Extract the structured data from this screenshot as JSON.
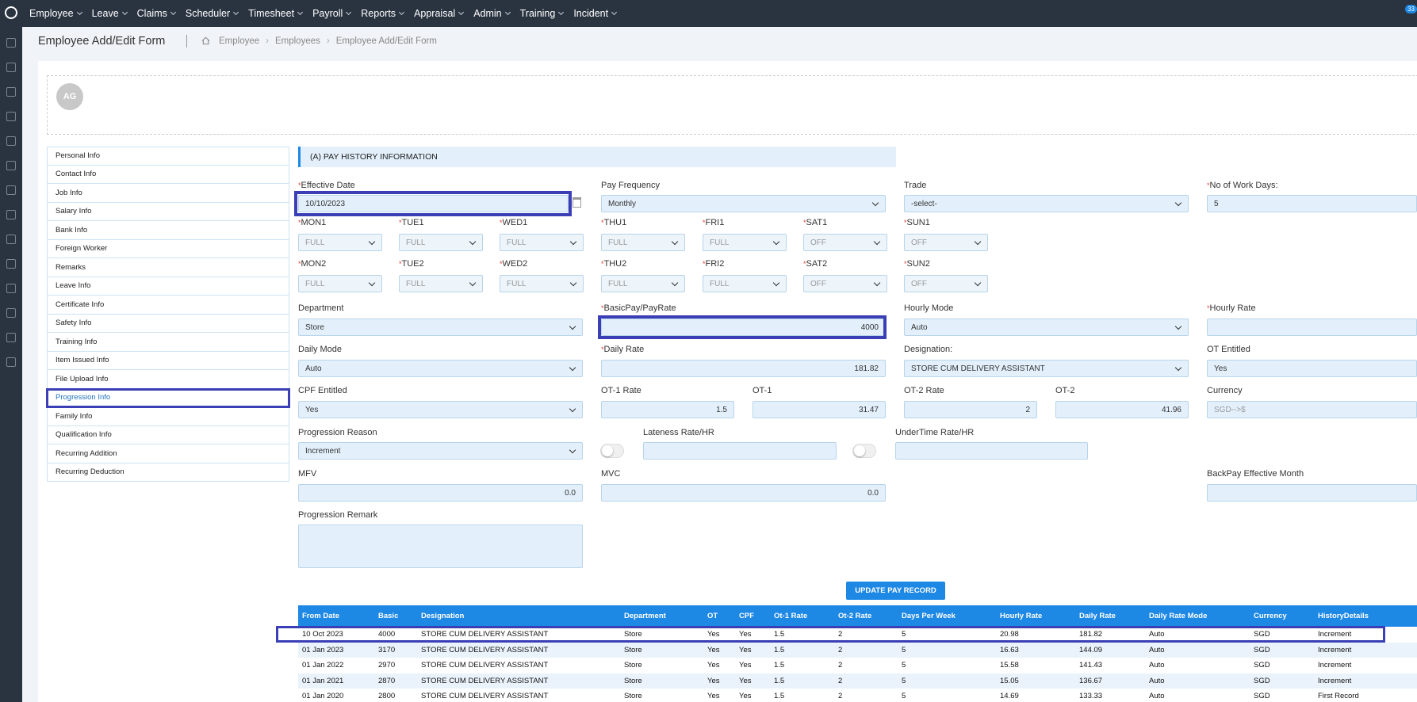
{
  "topnav": {
    "menu": [
      {
        "label": "Employee",
        "name": "menu-employee"
      },
      {
        "label": "Leave",
        "name": "menu-leave"
      },
      {
        "label": "Claims",
        "name": "menu-claims"
      },
      {
        "label": "Scheduler",
        "name": "menu-scheduler"
      },
      {
        "label": "Timesheet",
        "name": "menu-timesheet"
      },
      {
        "label": "Payroll",
        "name": "menu-payroll"
      },
      {
        "label": "Reports",
        "name": "menu-reports"
      },
      {
        "label": "Appraisal",
        "name": "menu-appraisal"
      },
      {
        "label": "Admin",
        "name": "menu-admin"
      },
      {
        "label": "Training",
        "name": "menu-training"
      },
      {
        "label": "Incident",
        "name": "menu-incident"
      }
    ],
    "notification_count": "33"
  },
  "header": {
    "title": "Employee Add/Edit Form",
    "breadcrumbs": [
      "Employee",
      "Employees",
      "Employee Add/Edit Form"
    ]
  },
  "avatar": {
    "initials": "AG"
  },
  "subnav": {
    "items": [
      "Personal Info",
      "Contact Info",
      "Job Info",
      "Salary Info",
      "Bank Info",
      "Foreign Worker",
      "Remarks",
      "Leave Info",
      "Certificate Info",
      "Safety Info",
      "Training Info",
      "Item Issued Info",
      "File Upload Info",
      "Progression Info",
      "Family Info",
      "Qualification Info",
      "Recurring Addition",
      "Recurring Deduction"
    ],
    "active": "Progression Info"
  },
  "form": {
    "section_title": "(A) PAY HISTORY INFORMATION",
    "effective_date": {
      "label": "Effective Date",
      "value": "10/10/2023"
    },
    "pay_frequency": {
      "label": "Pay Frequency",
      "value": "Monthly"
    },
    "trade": {
      "label": "Trade",
      "value": "-select-"
    },
    "work_days": {
      "label": "No of Work Days:",
      "value": "5"
    },
    "week1": [
      {
        "label": "MON1",
        "value": "FULL"
      },
      {
        "label": "TUE1",
        "value": "FULL"
      },
      {
        "label": "WED1",
        "value": "FULL"
      },
      {
        "label": "THU1",
        "value": "FULL"
      },
      {
        "label": "FRI1",
        "value": "FULL"
      },
      {
        "label": "SAT1",
        "value": "OFF"
      },
      {
        "label": "SUN1",
        "value": "OFF"
      }
    ],
    "week2": [
      {
        "label": "MON2",
        "value": "FULL"
      },
      {
        "label": "TUE2",
        "value": "FULL"
      },
      {
        "label": "WED2",
        "value": "FULL"
      },
      {
        "label": "THU2",
        "value": "FULL"
      },
      {
        "label": "FRI2",
        "value": "FULL"
      },
      {
        "label": "SAT2",
        "value": "OFF"
      },
      {
        "label": "SUN2",
        "value": "OFF"
      }
    ],
    "department": {
      "label": "Department",
      "value": "Store"
    },
    "basic_pay": {
      "label": "BasicPay/PayRate",
      "value": "4000"
    },
    "hourly_mode": {
      "label": "Hourly Mode",
      "value": "Auto"
    },
    "hourly_rate": {
      "label": "Hourly Rate",
      "value": ""
    },
    "daily_mode": {
      "label": "Daily Mode",
      "value": "Auto"
    },
    "daily_rate": {
      "label": "Daily Rate",
      "value": "181.82"
    },
    "designation": {
      "label": "Designation:",
      "value": "STORE CUM DELIVERY ASSISTANT"
    },
    "ot_entitled": {
      "label": "OT Entitled",
      "value": "Yes"
    },
    "cpf_entitled": {
      "label": "CPF Entitled",
      "value": "Yes"
    },
    "ot1_rate": {
      "label": "OT-1 Rate",
      "value": "1.5"
    },
    "ot1": {
      "label": "OT-1",
      "value": "31.47"
    },
    "ot2_rate": {
      "label": "OT-2 Rate",
      "value": "2"
    },
    "ot2": {
      "label": "OT-2",
      "value": "41.96"
    },
    "currency": {
      "label": "Currency",
      "value": "SGD-->$"
    },
    "progression_reason": {
      "label": "Progression Reason",
      "value": "Increment"
    },
    "lateness_rate": {
      "label": "Lateness Rate/HR",
      "value": ""
    },
    "undertime_rate": {
      "label": "UnderTime Rate/HR",
      "value": ""
    },
    "mfv": {
      "label": "MFV",
      "value": "0.0"
    },
    "mvc": {
      "label": "MVC",
      "value": "0.0"
    },
    "backpay_month": {
      "label": "BackPay Effective Month",
      "value": ""
    },
    "progression_remark": {
      "label": "Progression Remark",
      "value": ""
    },
    "update_button": "UPDATE PAY RECORD"
  },
  "history": {
    "columns": [
      "From Date",
      "Basic",
      "Designation",
      "Department",
      "OT",
      "CPF",
      "Ot-1 Rate",
      "Ot-2 Rate",
      "Days Per Week",
      "Hourly Rate",
      "Daily Rate",
      "Daily Rate Mode",
      "Currency",
      "HistoryDetails"
    ],
    "rows": [
      [
        "10 Oct 2023",
        "4000",
        "STORE CUM DELIVERY ASSISTANT",
        "Store",
        "Yes",
        "Yes",
        "1.5",
        "2",
        "5",
        "20.98",
        "181.82",
        "Auto",
        "SGD",
        "Increment"
      ],
      [
        "01 Jan 2023",
        "3170",
        "STORE CUM DELIVERY ASSISTANT",
        "Store",
        "Yes",
        "Yes",
        "1.5",
        "2",
        "5",
        "16.63",
        "144.09",
        "Auto",
        "SGD",
        "Increment"
      ],
      [
        "01 Jan 2022",
        "2970",
        "STORE CUM DELIVERY ASSISTANT",
        "Store",
        "Yes",
        "Yes",
        "1.5",
        "2",
        "5",
        "15.58",
        "141.43",
        "Auto",
        "SGD",
        "Increment"
      ],
      [
        "01 Jan 2021",
        "2870",
        "STORE CUM DELIVERY ASSISTANT",
        "Store",
        "Yes",
        "Yes",
        "1.5",
        "2",
        "5",
        "15.05",
        "136.67",
        "Auto",
        "SGD",
        "Increment"
      ],
      [
        "01 Jan 2020",
        "2800",
        "STORE CUM DELIVERY ASSISTANT",
        "Store",
        "Yes",
        "Yes",
        "1.5",
        "2",
        "5",
        "14.69",
        "133.33",
        "Auto",
        "SGD",
        "First Record"
      ]
    ]
  },
  "colors": {
    "topbar": "#2a3441",
    "accent": "#1e88e5",
    "highlight": "#3b3fb6",
    "field_bg": "#e3f0fb"
  }
}
